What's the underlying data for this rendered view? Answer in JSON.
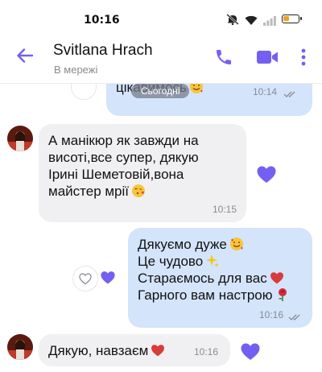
{
  "status_bar": {
    "time": "10:16"
  },
  "header": {
    "name": "Svitlana Hrach",
    "status": "В мережі"
  },
  "date_pill": "Сьогодні",
  "messages": [
    {
      "direction": "outgoing",
      "text": "цікавимось",
      "time": "10:14",
      "emoji": [
        "smiling-face-with-hearts"
      ],
      "read": true
    },
    {
      "direction": "incoming",
      "lines": [
        "А манікюр як завжди на",
        "висоті,все супер, дякую",
        "Ірині Шеметовій,вона",
        "майстер мрії"
      ],
      "time": "10:15",
      "emoji": [
        "kissing-face-with-heart"
      ],
      "liked": true
    },
    {
      "direction": "outgoing",
      "lines": [
        "Дякуємо дуже",
        "Це чудово",
        "Стараємось для вас",
        "Гарного вам настрою"
      ],
      "emoji": [
        "smiling-face-with-hearts",
        "sparkles",
        "red-heart",
        "rose"
      ],
      "time": "10:16",
      "read": true,
      "liked": true
    },
    {
      "direction": "incoming",
      "text": "Дякую, навзаєм",
      "emoji": [
        "red-heart"
      ],
      "time": "10:16",
      "liked": true
    }
  ],
  "colors": {
    "accent": "#7360f2",
    "outgoing_bubble": "#d3e4fb",
    "incoming_bubble": "#f0f0f2",
    "heart": "#d93a3a"
  },
  "icons": [
    "back-arrow-icon",
    "phone-icon",
    "video-camera-icon",
    "more-vertical-icon",
    "heart-icon"
  ]
}
